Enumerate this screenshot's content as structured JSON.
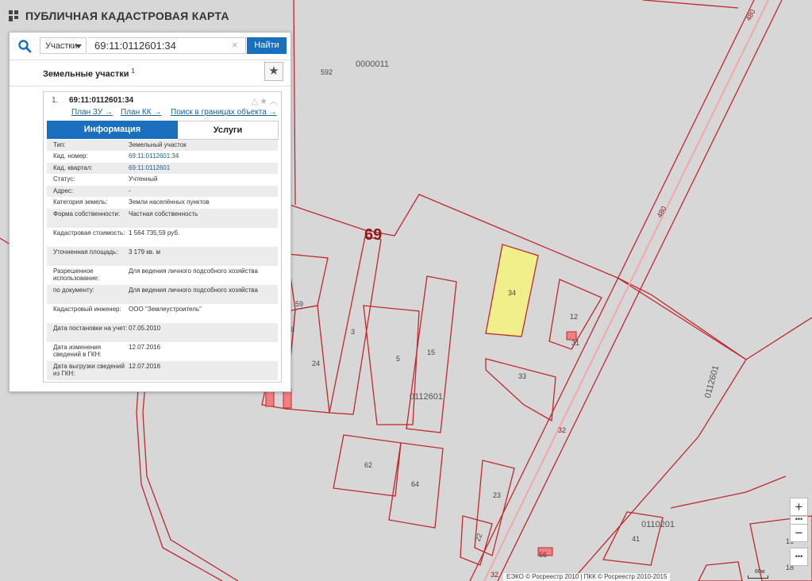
{
  "app": {
    "title": "ПУБЛИЧНАЯ КАДАСТРОВАЯ КАРТА"
  },
  "search": {
    "type_value": "Участки",
    "query_value": "69:11:0112601:34",
    "clear_symbol": "×",
    "find_label": "Найти"
  },
  "results": {
    "title": "Земельные участки",
    "count": "1",
    "item": {
      "index": "1.",
      "number": "69:11:0112601:34",
      "links": [
        "План ЗУ →",
        "План КК →",
        "Поиск в границах объекта →"
      ],
      "tabs": {
        "info": "Информация",
        "services": "Услуги"
      }
    }
  },
  "info_rows": [
    {
      "label": "Тип:",
      "value": "Земельный участок"
    },
    {
      "label": "Кад. номер:",
      "value": "69:11:0112601:34"
    },
    {
      "label": "Кад. квартал:",
      "value": "69:11:0112601"
    },
    {
      "label": "Статус:",
      "value": "Учтенный"
    },
    {
      "label": "Адрес:",
      "value": "-"
    },
    {
      "label": "Категория земель:",
      "value": "Земли населённых пунктов"
    },
    {
      "label": "Форма собственности:",
      "value": "Частная собственность"
    },
    {
      "label": "Кадастровая стоимость:",
      "value": "1 564 735,59 руб."
    },
    {
      "label": "Уточненная площадь:",
      "value": "3 179 кв. м"
    },
    {
      "label": "Разрешенное использование:",
      "value": "Для ведения личного подсобного хозяйства"
    },
    {
      "label": "по документу:",
      "value": "Для ведения личного подсобного хозяйства"
    },
    {
      "label": "Кадастровый инженер:",
      "value": "ООО \"Землеустроитель\""
    },
    {
      "label": "Дата постановки на учет:",
      "value": "07.05.2010"
    },
    {
      "label": "Дата изменения сведений в ГКН:",
      "value": "12.07.2016"
    },
    {
      "label": "Дата выгрузки сведений из ГКН:",
      "value": "12.07.2016"
    }
  ],
  "map": {
    "region_label": "69",
    "quarter_labels": [
      "0000011",
      "0112601",
      "0110201",
      "0112601"
    ],
    "road_labels": [
      "480",
      "480",
      "32",
      "32"
    ],
    "parcel_labels": [
      "592",
      "59",
      "6",
      "3",
      "24",
      "5",
      "15",
      "34",
      "12",
      "31",
      "33",
      "62",
      "64",
      "23",
      "22",
      "41",
      "56",
      "16",
      "18"
    ],
    "selected_fill": "#f0ef8a",
    "boundary_color": "#c0282d"
  },
  "controls": {
    "zoom_in": "+",
    "zoom_out": "−",
    "more": "•••",
    "scale": "60м",
    "copyright": "ЕЭКО © Росреестр 2010 | ПКК © Росреестр 2010-2015"
  },
  "colors": {
    "accent": "#1b6fbf",
    "link": "#1a5f96",
    "map_bg": "#d7d7d7"
  }
}
